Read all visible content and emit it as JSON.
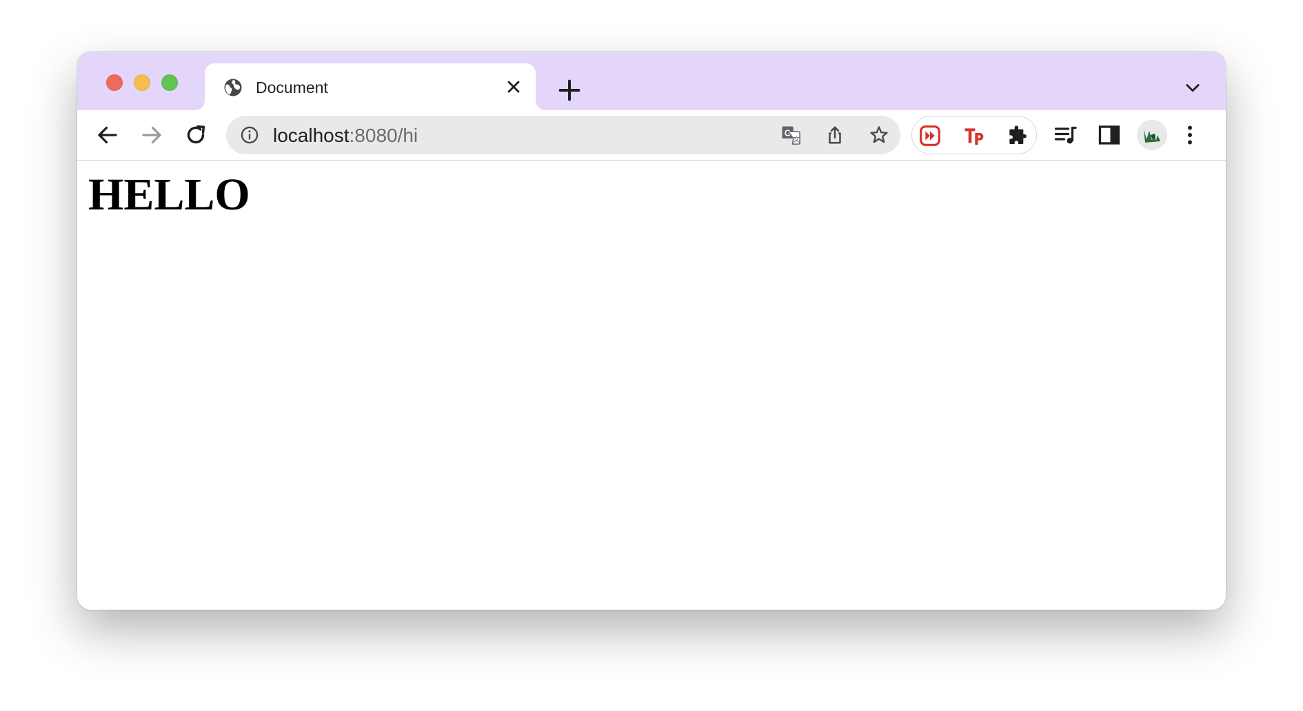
{
  "tabstrip": {
    "tab": {
      "title": "Document",
      "favicon": "globe-icon"
    },
    "new_tab_icon": "plus-icon",
    "tab_search_icon": "chevron-down-icon"
  },
  "toolbar": {
    "back_icon": "arrow-left-icon",
    "forward_icon": "arrow-right-icon",
    "reload_icon": "reload-icon",
    "omnibox": {
      "info_icon": "info-icon",
      "url_host": "localhost",
      "url_rest": ":8080/hi",
      "actions": [
        "translate-icon",
        "share-icon",
        "bookmark-star-icon"
      ]
    },
    "extensions": [
      "fast-forward-extension-icon",
      "tp-extension-icon",
      "puzzle-extensions-icon"
    ],
    "media_icon": "media-queue-icon",
    "side_panel_icon": "side-panel-icon",
    "profile_icon": "avatar",
    "menu_icon": "kebab-menu-icon"
  },
  "page": {
    "heading": "HELLO"
  },
  "colors": {
    "tabstrip_bg": "#e4d6fb",
    "omnibox_bg": "#e9e9ea",
    "close_red": "#ee6a5f",
    "minimize_yellow": "#f5bd4f",
    "zoom_green": "#61c454",
    "ext_red": "#d6332c"
  }
}
